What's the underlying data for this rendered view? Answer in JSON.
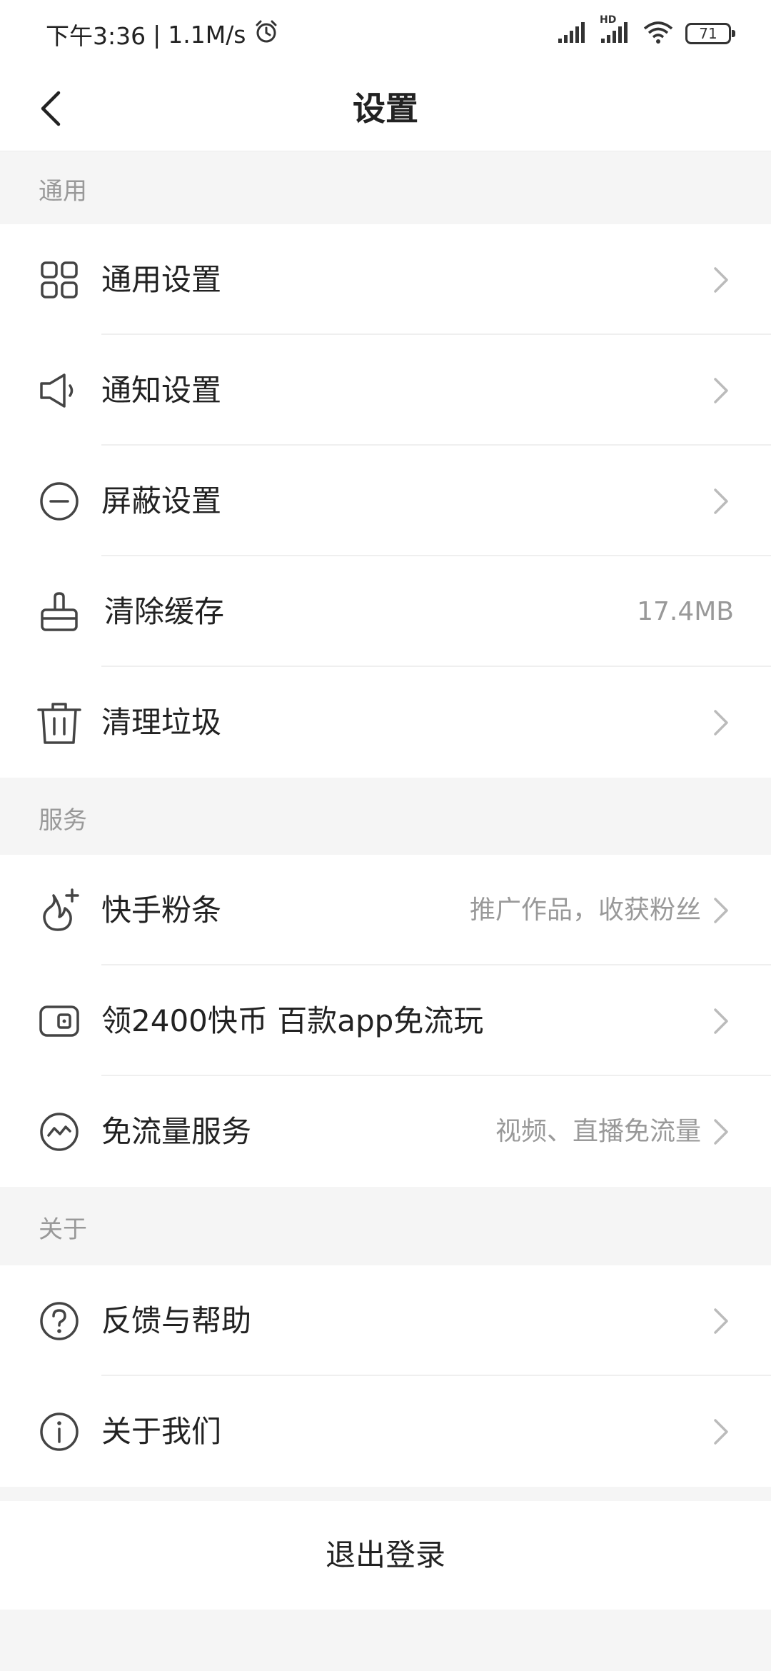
{
  "status_bar": {
    "time": "下午3:36",
    "separator": "|",
    "speed": "1.1M/s",
    "battery": "71",
    "hd_label": "HD"
  },
  "header": {
    "title": "设置"
  },
  "sections": {
    "general": {
      "title": "通用",
      "items": [
        {
          "label": "通用设置",
          "icon": "grid-icon"
        },
        {
          "label": "通知设置",
          "icon": "speaker-icon"
        },
        {
          "label": "屏蔽设置",
          "icon": "minus-circle-icon"
        },
        {
          "label": "清除缓存",
          "icon": "brush-icon",
          "value": "17.4MB"
        },
        {
          "label": "清理垃圾",
          "icon": "trash-icon"
        }
      ]
    },
    "services": {
      "title": "服务",
      "items": [
        {
          "label": "快手粉条",
          "icon": "fan-plus-icon",
          "hint": "推广作品，收获粉丝"
        },
        {
          "label": "领2400快币 百款app免流玩",
          "icon": "coin-card-icon"
        },
        {
          "label": "免流量服务",
          "icon": "wave-circle-icon",
          "hint": "视频、直播免流量"
        }
      ]
    },
    "about": {
      "title": "关于",
      "items": [
        {
          "label": "反馈与帮助",
          "icon": "question-circle-icon"
        },
        {
          "label": "关于我们",
          "icon": "info-circle-icon"
        }
      ]
    }
  },
  "logout": {
    "label": "退出登录"
  },
  "colors": {
    "background": "#f5f5f5",
    "text": "#222222",
    "secondary": "#999999",
    "chevron": "#bbbbbb"
  }
}
